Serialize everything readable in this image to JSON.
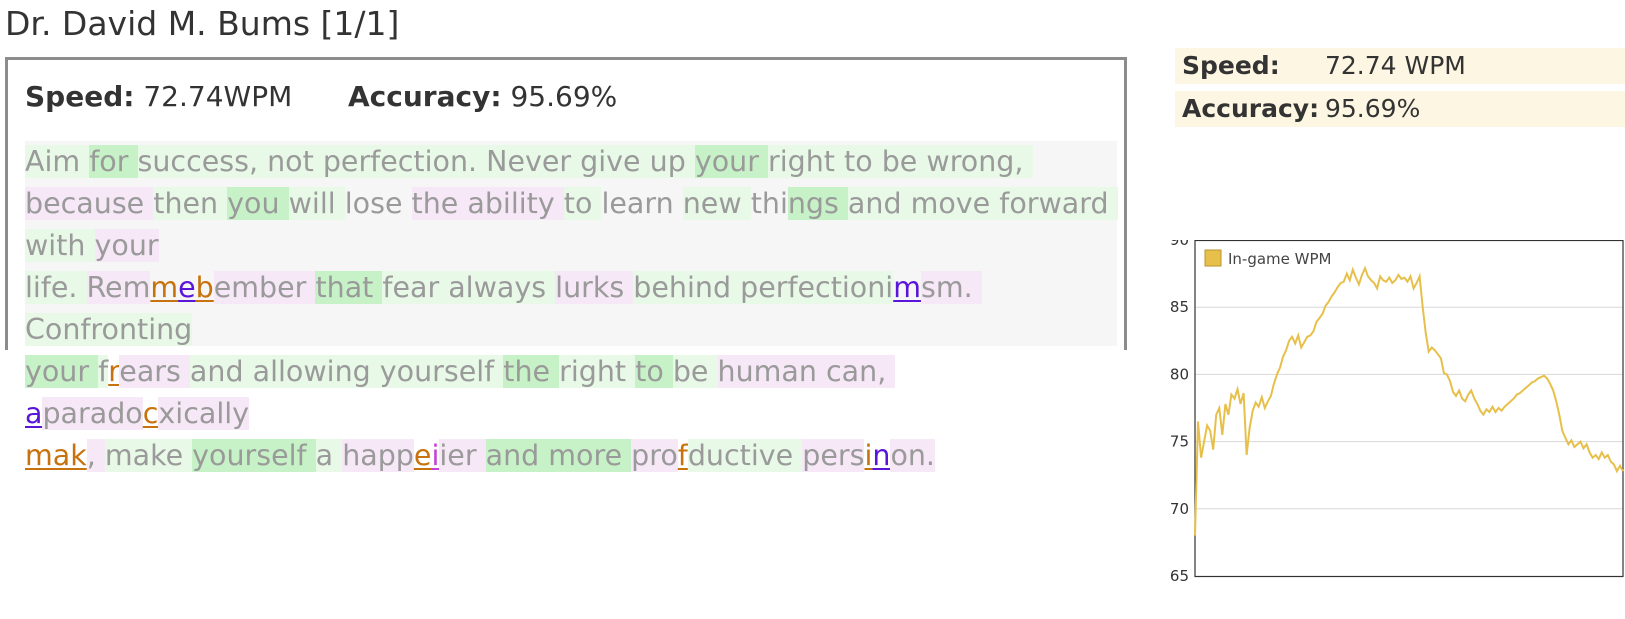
{
  "player": {
    "name": "Dr. David M. Bums [1/1]"
  },
  "result": {
    "speed_label": "Speed:",
    "speed_value": "72.74WPM",
    "accuracy_label": "Accuracy:",
    "accuracy_value": "95.69%",
    "typed_segments": [
      [
        "Aim ",
        "g"
      ],
      [
        "for ",
        "G"
      ],
      [
        "success, ",
        "g"
      ],
      [
        "not ",
        "g"
      ],
      [
        "perfection. ",
        "g"
      ],
      [
        "Never ",
        "g"
      ],
      [
        "give ",
        "g"
      ],
      [
        "up ",
        "g"
      ],
      [
        "your ",
        "G"
      ],
      [
        "right ",
        "g"
      ],
      [
        "to ",
        "g"
      ],
      [
        "be ",
        "g"
      ],
      [
        "wrong, ",
        "g"
      ],
      [
        "because ",
        "p"
      ],
      [
        "then ",
        "g"
      ],
      [
        "you ",
        "G"
      ],
      [
        "will ",
        "g"
      ],
      [
        "lose ",
        ""
      ],
      [
        "the ",
        "p"
      ],
      [
        "ability ",
        "p"
      ],
      [
        "to ",
        "g"
      ],
      [
        "learn ",
        ""
      ],
      [
        "new ",
        "g"
      ],
      [
        "thi",
        "n"
      ],
      [
        "ngs ",
        "G"
      ],
      [
        "and ",
        "g"
      ],
      [
        "move ",
        "g"
      ],
      [
        "forward ",
        "g"
      ],
      [
        "with ",
        "g"
      ],
      [
        "your",
        "p"
      ],
      [
        "\n",
        ""
      ],
      [
        "life. ",
        "g"
      ],
      [
        "Rem",
        "p"
      ],
      [
        "m",
        "eo"
      ],
      [
        "e",
        "eb"
      ],
      [
        "b",
        "eo"
      ],
      [
        "ember ",
        "p"
      ],
      [
        "that ",
        "G"
      ],
      [
        "fear ",
        "g"
      ],
      [
        "always ",
        "g"
      ],
      [
        "lurks ",
        "p"
      ],
      [
        "behind ",
        "g"
      ],
      [
        "perfectioni",
        "g"
      ],
      [
        "m",
        "eb"
      ],
      [
        "sm. ",
        "p"
      ],
      [
        "Confronting",
        "g"
      ],
      [
        "\n",
        ""
      ],
      [
        "your ",
        "G"
      ],
      [
        "f",
        "g"
      ],
      [
        "r",
        "eo"
      ],
      [
        "ears ",
        "p"
      ],
      [
        "and ",
        "g"
      ],
      [
        "allowing ",
        "g"
      ],
      [
        "yourself ",
        "g"
      ],
      [
        "the ",
        "G"
      ],
      [
        "right ",
        "g"
      ],
      [
        "to ",
        "G"
      ],
      [
        "be ",
        "g"
      ],
      [
        "human ",
        "p"
      ],
      [
        "can, ",
        "p"
      ],
      [
        "a",
        "eb"
      ],
      [
        "parado",
        "p"
      ],
      [
        "c",
        "eo"
      ],
      [
        "xically",
        "p"
      ],
      [
        "\n",
        ""
      ],
      [
        "mak",
        "eo"
      ],
      [
        ", ",
        "p"
      ],
      [
        "make ",
        "g"
      ],
      [
        "yourself ",
        "G"
      ],
      [
        "a ",
        "g"
      ],
      [
        "happ",
        "p"
      ],
      [
        "e",
        "eo"
      ],
      [
        "i",
        "em"
      ],
      [
        "ier ",
        "p"
      ],
      [
        "and more ",
        "G"
      ],
      [
        "pro",
        "p"
      ],
      [
        "f",
        "eo"
      ],
      [
        "ductive ",
        "g"
      ],
      [
        "pers",
        "p"
      ],
      [
        "i",
        "eo"
      ],
      [
        "n",
        "eb"
      ],
      [
        "on.",
        "p"
      ]
    ]
  },
  "side_stats": {
    "speed_label": "Speed:",
    "speed_value": "72.74 WPM",
    "accuracy_label": "Accuracy:",
    "accuracy_value": "95.69%"
  },
  "chart_data": {
    "type": "line",
    "title": "",
    "xlabel": "",
    "ylabel": "",
    "ylim": [
      65,
      90
    ],
    "yticks": [
      65,
      70,
      75,
      80,
      85,
      90
    ],
    "grid": true,
    "legend": "top-left",
    "series": [
      {
        "name": "In-game WPM",
        "color": "#e7c04b",
        "values": [
          68.0,
          76.5,
          73.8,
          75.0,
          76.2,
          75.8,
          74.4,
          77.0,
          77.5,
          75.5,
          77.8,
          77.0,
          78.5,
          78.2,
          78.9,
          77.8,
          78.6,
          74.0,
          76.0,
          77.3,
          77.9,
          77.6,
          78.3,
          77.5,
          78.0,
          78.4,
          79.3,
          80.0,
          80.5,
          81.3,
          81.8,
          82.5,
          82.8,
          82.3,
          82.9,
          82.0,
          82.4,
          82.8,
          82.9,
          83.2,
          83.9,
          84.2,
          84.5,
          85.1,
          85.4,
          85.8,
          86.1,
          86.5,
          86.8,
          86.9,
          87.5,
          87.0,
          87.8,
          87.2,
          86.7,
          87.4,
          87.9,
          87.3,
          87.0,
          86.8,
          86.4,
          87.3,
          87.0,
          86.9,
          87.2,
          86.8,
          87.0,
          87.4,
          87.1,
          87.2,
          86.9,
          87.3,
          86.4,
          86.8,
          87.3,
          85.0,
          83.1,
          81.7,
          82.0,
          81.8,
          81.5,
          81.2,
          80.1,
          80.0,
          79.5,
          78.7,
          78.4,
          78.8,
          78.2,
          78.0,
          78.5,
          78.8,
          78.2,
          77.8,
          77.3,
          77.0,
          77.4,
          77.2,
          77.6,
          77.2,
          77.5,
          77.3,
          77.6,
          77.8,
          78.0,
          78.2,
          78.5,
          78.6,
          78.8,
          79.0,
          79.2,
          79.4,
          79.5,
          79.7,
          79.8,
          79.9,
          79.7,
          79.3,
          78.8,
          78.0,
          77.0,
          75.8,
          75.3,
          74.8,
          75.1,
          74.6,
          74.8,
          75.0,
          74.5,
          74.8,
          74.2,
          73.8,
          74.0,
          73.7,
          74.2,
          73.8,
          74.0,
          73.5,
          73.3,
          72.8,
          73.2,
          72.8
        ]
      }
    ]
  }
}
